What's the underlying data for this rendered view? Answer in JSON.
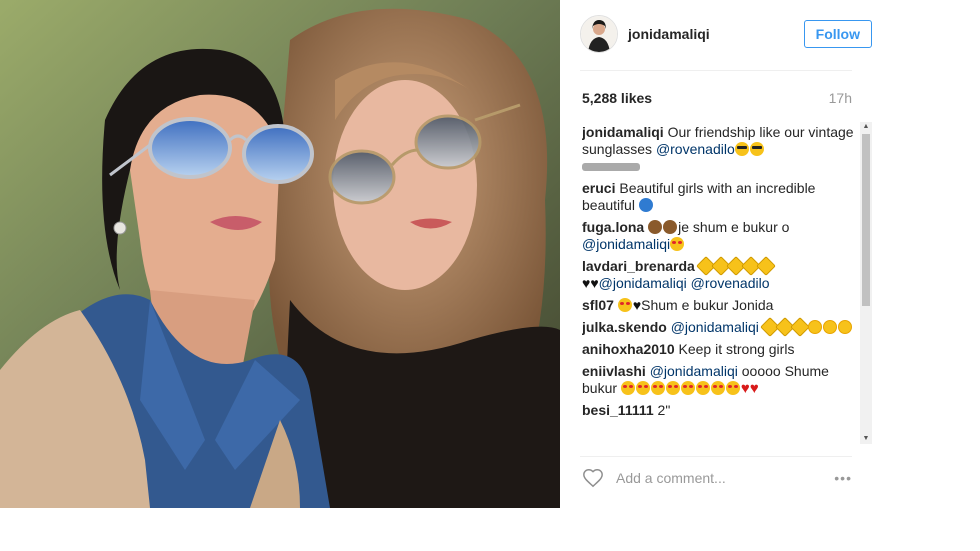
{
  "post": {
    "username": "jonidamaliqi",
    "follow_label": "Follow",
    "likes": "5,288 likes",
    "time": "17h",
    "comment_placeholder": "Add a comment...",
    "more_label": "•••"
  },
  "comments": [
    {
      "user": "jonidamaliqi",
      "parts": [
        {
          "t": "Our friendship like our vintage sunglasses "
        },
        {
          "m": "@rovenadilo"
        },
        {
          "e": "cool"
        },
        {
          "e": "cool"
        }
      ],
      "blot": true
    },
    {
      "user": "eruci",
      "parts": [
        {
          "t": "Beautiful girls with an incredible beautiful "
        },
        {
          "e": "globe"
        }
      ]
    },
    {
      "user": "fuga.lona",
      "parts": [
        {
          "e": "monkey"
        },
        {
          "e": "monkey"
        },
        {
          "t": "je shum e bukur o "
        },
        {
          "m": "@jonidamaliqi"
        },
        {
          "e": "love"
        }
      ]
    },
    {
      "user": "lavdari_brenarda",
      "parts": [
        {
          "e": "sun"
        },
        {
          "e": "sun"
        },
        {
          "e": "sun"
        },
        {
          "e": "sun"
        },
        {
          "e": "sun"
        },
        {
          "e": "bheart"
        },
        {
          "e": "bheart"
        },
        {
          "m": "@jonidamaliqi"
        },
        {
          "m": " @rovenadilo"
        }
      ]
    },
    {
      "user": "sfl07",
      "parts": [
        {
          "e": "love"
        },
        {
          "e": "bheart"
        },
        {
          "t": "Shum e bukur Jonida"
        }
      ]
    },
    {
      "user": "julka.skendo",
      "parts": [
        {
          "m": "@jonidamaliqi"
        },
        {
          "t": " "
        },
        {
          "e": "sun"
        },
        {
          "e": "sun"
        },
        {
          "e": "sun"
        },
        {
          "e": "sunny"
        },
        {
          "e": "sunny"
        },
        {
          "e": "sunny"
        }
      ]
    },
    {
      "user": "anihoxha2010",
      "parts": [
        {
          "t": "Keep it strong girls"
        }
      ]
    },
    {
      "user": "eniivlashi",
      "parts": [
        {
          "m": "@jonidamaliqi"
        },
        {
          "t": " ooooo Shume bukur "
        },
        {
          "e": "love"
        },
        {
          "e": "love"
        },
        {
          "e": "love"
        },
        {
          "e": "love"
        },
        {
          "e": "love"
        },
        {
          "e": "love"
        },
        {
          "e": "love"
        },
        {
          "e": "love"
        },
        {
          "e": "heart"
        },
        {
          "e": "heart"
        }
      ]
    },
    {
      "user": "besi_11111",
      "parts": [
        {
          "t": "2\""
        }
      ]
    }
  ],
  "icons": {
    "like": "heart-outline-icon",
    "more": "ellipsis-icon",
    "avatar": "profile-photo"
  },
  "colors": {
    "link": "#003569",
    "follow": "#3897f0",
    "muted": "#999999"
  }
}
